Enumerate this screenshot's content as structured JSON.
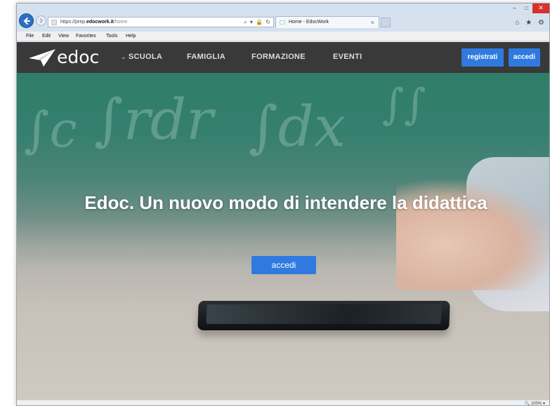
{
  "browser": {
    "address": {
      "scheme": "https://prep.",
      "domain": "edocwork.it",
      "path": "/home",
      "tools": "⌕ ▾ 🔒 ↻"
    },
    "tab": {
      "title": "Home - EdocWork",
      "close": "×"
    },
    "window_controls": {
      "minimize": "–",
      "maximize": "□",
      "close": "✕"
    },
    "right_icons": "⌂ ★ ⚙",
    "menu": [
      "File",
      "Edit",
      "View",
      "Favorites",
      "Tools",
      "Help"
    ],
    "zoom": "🔍 100%  ▾"
  },
  "site": {
    "logo_text": "edoc",
    "nav": [
      {
        "label": "SCUOLA",
        "chevron": "⌄"
      },
      {
        "label": "FAMIGLIA"
      },
      {
        "label": "FORMAZIONE"
      },
      {
        "label": "EVENTI"
      }
    ],
    "register_label": "registrati",
    "login_label": "accedi"
  },
  "hero": {
    "title": "Edoc. Un nuovo modo di intendere la didattica",
    "button_label": "accedi"
  },
  "colors": {
    "nav_bg": "#393939",
    "accent_blue": "#2f7ae0",
    "chalkboard": "#2f7d6a"
  }
}
